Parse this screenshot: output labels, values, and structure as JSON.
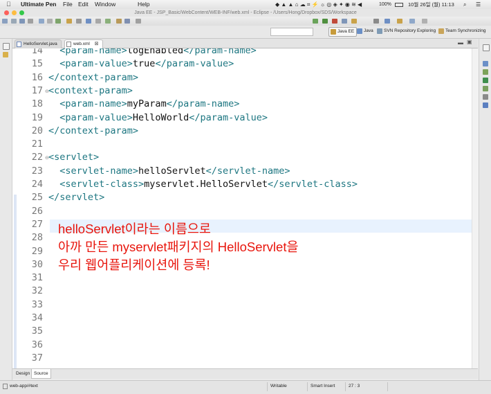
{
  "menubar": {
    "app_name": "Ultimate Pen",
    "items": [
      "File",
      "Edit",
      "Window",
      "Help"
    ],
    "battery": "100%",
    "datetime": "10월 26일 (월)  11:13"
  },
  "window": {
    "title": "Java EE - JSP_Basic/WebContent/WEB-INF/web.xml - Eclipse - /Users/Hong/Dropbox/SDS/Workspace"
  },
  "perspectives": [
    {
      "label": "Java EE",
      "active": true,
      "icon": "javaee-icon"
    },
    {
      "label": "Java",
      "active": false,
      "icon": "java-icon"
    },
    {
      "label": "SVN Repository Exploring",
      "active": false,
      "icon": "svn-icon"
    },
    {
      "label": "Team Synchronizing",
      "active": false,
      "icon": "sync-icon"
    }
  ],
  "editor_tabs": [
    {
      "label": "HelloServlet.java",
      "active": false
    },
    {
      "label": "web.xml",
      "active": true,
      "close": "⊠"
    }
  ],
  "code_lines": [
    {
      "n": "14",
      "parts": [
        [
          "tag",
          "  <param-name>"
        ],
        [
          "txt",
          "logEnabled"
        ],
        [
          "tag",
          "</param-name>"
        ]
      ]
    },
    {
      "n": "15",
      "parts": [
        [
          "tag",
          "  <param-value>"
        ],
        [
          "txt",
          "true"
        ],
        [
          "tag",
          "</param-value>"
        ]
      ]
    },
    {
      "n": "16",
      "parts": [
        [
          "tag",
          "</context-param>"
        ]
      ]
    },
    {
      "n": "17",
      "fold": "⊖",
      "parts": [
        [
          "tag",
          "<context-param>"
        ]
      ]
    },
    {
      "n": "18",
      "parts": [
        [
          "tag",
          "  <param-name>"
        ],
        [
          "txt",
          "myParam"
        ],
        [
          "tag",
          "</param-name>"
        ]
      ]
    },
    {
      "n": "19",
      "parts": [
        [
          "tag",
          "  <param-value>"
        ],
        [
          "txt",
          "HelloWorld"
        ],
        [
          "tag",
          "</param-value>"
        ]
      ]
    },
    {
      "n": "20",
      "parts": [
        [
          "tag",
          "</context-param>"
        ]
      ]
    },
    {
      "n": "21",
      "parts": []
    },
    {
      "n": "22",
      "fold": "⊖",
      "parts": [
        [
          "tag",
          "<servlet>"
        ]
      ]
    },
    {
      "n": "23",
      "parts": [
        [
          "tag",
          "  <servlet-name>"
        ],
        [
          "txt",
          "helloServlet"
        ],
        [
          "tag",
          "</servlet-name>"
        ]
      ]
    },
    {
      "n": "24",
      "parts": [
        [
          "tag",
          "  <servlet-class>"
        ],
        [
          "txt",
          "myservlet.HelloServlet"
        ],
        [
          "tag",
          "</servlet-class>"
        ]
      ]
    },
    {
      "n": "25",
      "parts": [
        [
          "tag",
          "</servlet>"
        ]
      ]
    },
    {
      "n": "26",
      "parts": []
    },
    {
      "n": "27",
      "parts": []
    },
    {
      "n": "28",
      "parts": []
    },
    {
      "n": "29",
      "parts": []
    },
    {
      "n": "30",
      "parts": []
    },
    {
      "n": "31",
      "parts": []
    },
    {
      "n": "32",
      "parts": []
    },
    {
      "n": "33",
      "parts": []
    },
    {
      "n": "34",
      "parts": []
    },
    {
      "n": "35",
      "parts": []
    },
    {
      "n": "36",
      "parts": []
    },
    {
      "n": "37",
      "parts": []
    }
  ],
  "annotation": {
    "lines": [
      "helloServlet이라는 이름으로",
      "아까 만든 myservlet패키지의 HelloServlet을",
      "우리 웹어플리케이션에 등록!"
    ],
    "color": "#e8150c"
  },
  "bottom_tabs": [
    {
      "label": "Design",
      "active": false
    },
    {
      "label": "Source",
      "active": true
    }
  ],
  "statusbar": {
    "path": "web-app/#text",
    "mode": "Writable",
    "insert": "Smart Insert",
    "position": "27 : 3"
  }
}
